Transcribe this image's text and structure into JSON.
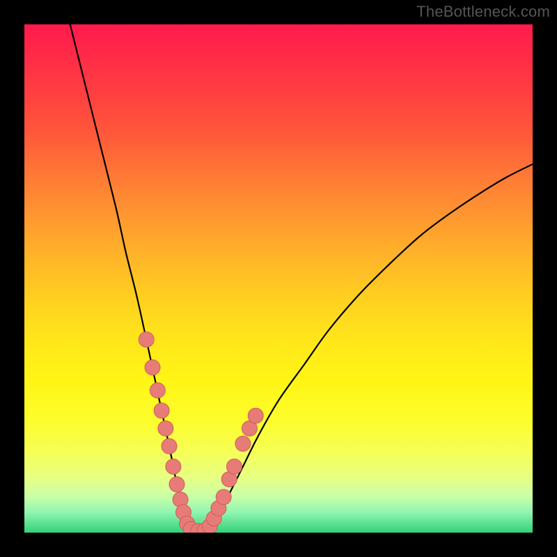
{
  "watermark": "TheBottleneck.com",
  "colors": {
    "background": "#000000",
    "curve": "#000000",
    "marker_fill": "#e77b78",
    "marker_stroke": "#cf5e58"
  },
  "chart_data": {
    "type": "line",
    "title": "",
    "xlabel": "",
    "ylabel": "",
    "xlim": [
      0,
      100
    ],
    "ylim": [
      0,
      100
    ],
    "grid": false,
    "series": [
      {
        "name": "curve-left",
        "x": [
          9,
          12,
          15,
          18,
          20,
          22,
          24,
          25.5,
          27,
          28.5,
          29.5,
          30.3,
          31,
          31.6,
          32.2
        ],
        "values": [
          100,
          88,
          76,
          64,
          55,
          47,
          38,
          31,
          24,
          17,
          12,
          8,
          4.5,
          2,
          0.5
        ]
      },
      {
        "name": "curve-bottom",
        "x": [
          32.2,
          33.5,
          35,
          36.5
        ],
        "values": [
          0.5,
          0,
          0,
          0.5
        ]
      },
      {
        "name": "curve-right",
        "x": [
          36.5,
          38,
          40,
          43,
          46,
          50,
          55,
          60,
          66,
          72,
          78,
          84,
          90,
          95,
          100
        ],
        "values": [
          0.5,
          3,
          7,
          13,
          19,
          26,
          33,
          40,
          47,
          53,
          58.5,
          63,
          67,
          70,
          72.5
        ]
      }
    ],
    "markers": [
      {
        "x": 24.0,
        "y": 38.0
      },
      {
        "x": 25.2,
        "y": 32.5
      },
      {
        "x": 26.2,
        "y": 28.0
      },
      {
        "x": 27.0,
        "y": 24.0
      },
      {
        "x": 27.8,
        "y": 20.5
      },
      {
        "x": 28.5,
        "y": 17.0
      },
      {
        "x": 29.3,
        "y": 13.0
      },
      {
        "x": 30.0,
        "y": 9.5
      },
      {
        "x": 30.7,
        "y": 6.5
      },
      {
        "x": 31.3,
        "y": 4.0
      },
      {
        "x": 32.0,
        "y": 1.8
      },
      {
        "x": 32.8,
        "y": 0.7
      },
      {
        "x": 34.2,
        "y": 0.3
      },
      {
        "x": 35.5,
        "y": 0.4
      },
      {
        "x": 36.5,
        "y": 1.3
      },
      {
        "x": 37.3,
        "y": 2.8
      },
      {
        "x": 38.2,
        "y": 4.8
      },
      {
        "x": 39.2,
        "y": 7.0
      },
      {
        "x": 40.3,
        "y": 10.5
      },
      {
        "x": 41.3,
        "y": 13.0
      },
      {
        "x": 43.0,
        "y": 17.5
      },
      {
        "x": 44.3,
        "y": 20.5
      },
      {
        "x": 45.5,
        "y": 23.0
      }
    ]
  }
}
